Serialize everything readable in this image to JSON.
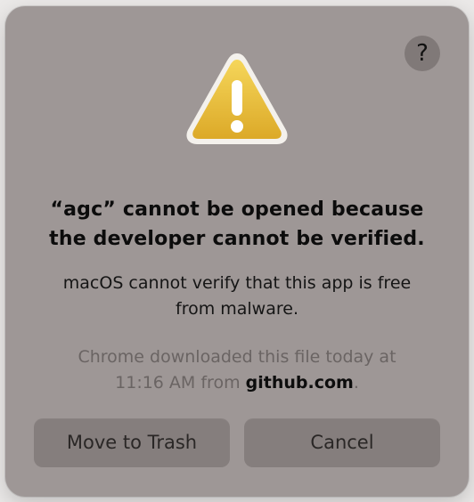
{
  "dialog": {
    "help_label": "?",
    "icon": "warning-triangle-icon",
    "title_lines": [
      "“agc” cannot be opened because",
      "the developer cannot be verified."
    ],
    "message_lines": [
      "macOS cannot verify that this app is free",
      "from malware."
    ],
    "info": {
      "line1": "Chrome downloaded this file today at",
      "line2_prefix": "11:16 AM from ",
      "line2_host": "github.com",
      "line2_suffix": "."
    },
    "buttons": {
      "move_to_trash": "Move to Trash",
      "cancel": "Cancel"
    },
    "colors": {
      "dialog_background": "#9e9796",
      "button_background": "#857e7d",
      "warning_yellow": "#e9bb35"
    }
  }
}
